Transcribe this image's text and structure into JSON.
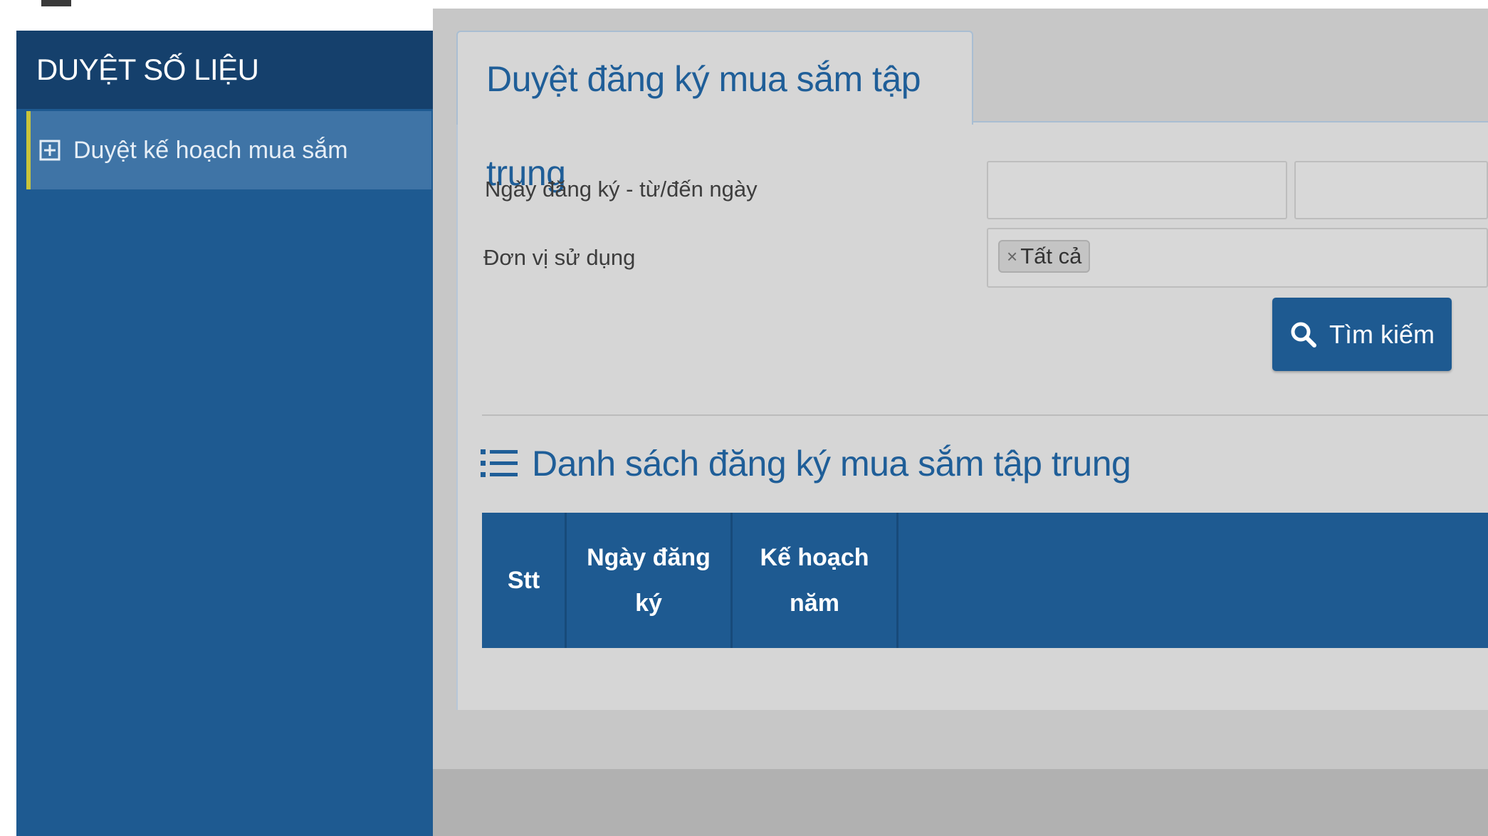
{
  "sidebar": {
    "header": "DUYỆT SỐ LIỆU",
    "items": [
      {
        "label": "Duyệt kế hoạch mua sắm",
        "icon": "plus-square-icon"
      }
    ]
  },
  "tab": {
    "title": "Duyệt đăng ký mua sắm tập trung"
  },
  "filters": {
    "date_label": "Ngày đăng ký - từ/đến ngày",
    "date_from": "",
    "date_to": "",
    "unit_label": "Đơn vị sử dụng",
    "unit_tag": "Tất cả",
    "unit_tag_remove": "×"
  },
  "search_button": {
    "label": "Tìm kiếm",
    "icon": "search-icon"
  },
  "list": {
    "title": "Danh sách đăng ký mua sắm tập trung",
    "icon": "list-icon",
    "columns": [
      "Stt",
      "Ngày đăng ký",
      "Kế hoạch năm"
    ]
  },
  "colors": {
    "primary": "#1e5a91",
    "sidebar_header": "#15406c",
    "accent_bar": "#c9c43b"
  }
}
